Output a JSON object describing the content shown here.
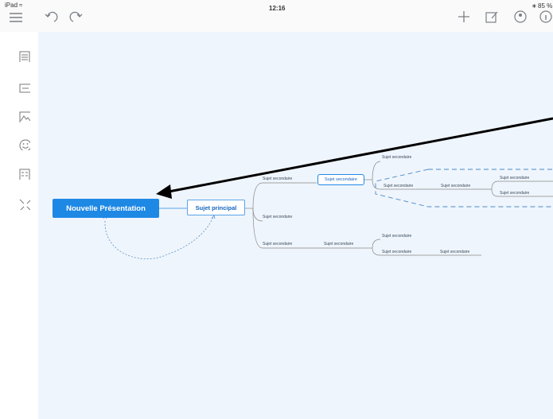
{
  "status_bar": {
    "device": "iPad",
    "time": "12:16",
    "battery": "85 %"
  },
  "toolbar": {
    "icons": [
      "menu-icon",
      "undo-icon",
      "redo-icon",
      "add-icon",
      "edit-icon",
      "theme-icon",
      "info-icon"
    ]
  },
  "sidebar": {
    "icons": [
      "outline-icon",
      "relationship-icon",
      "image-icon",
      "emoji-icon",
      "notes-icon",
      "collapse-icon"
    ]
  },
  "map": {
    "root": "Nouvelle Présentation",
    "main_topic": "Sujet principal",
    "subtopics": {
      "s1": "Sujet secondaire",
      "s2": "Sujet secondaire",
      "s3": "Sujet secondaire",
      "s4": "Sujet secondaire",
      "s5": "Sujet secondaire",
      "s6": "Sujet secondaire",
      "s7": "Sujet secondaire",
      "s8": "Sujet secondaire",
      "s9": "Sujet secondaire",
      "s10": "Sujet secondaire",
      "s11": "Sujet secondaire",
      "s12": "Sujet secondaire",
      "s13": "Sujet secondaire"
    }
  }
}
